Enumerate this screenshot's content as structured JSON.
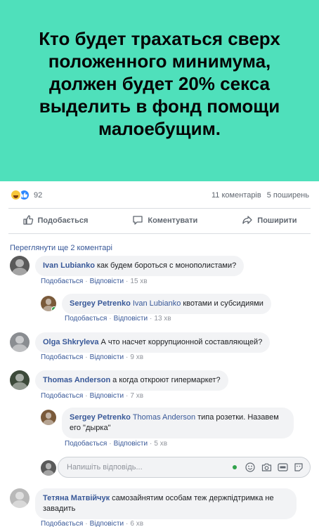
{
  "post": {
    "text": "Кто будет трахаться сверх\nположенного минимума,\nдолжен будет 20% секса\nвыделить в фонд помощи\nмалоебущим.",
    "background_color": "#4fe0bb"
  },
  "stats": {
    "reaction_count": "92",
    "comments": "11 коментарів",
    "shares": "5 поширень"
  },
  "actions": {
    "like": "Подобається",
    "comment": "Коментувати",
    "share": "Поширити"
  },
  "more_comments": "Переглянути ще 2 коментарі",
  "meta_labels": {
    "like": "Подобається",
    "reply": "Відповісти",
    "separator": "·"
  },
  "comments": [
    {
      "author": "Ivan Lubianko",
      "mention": "",
      "text": "как будем бороться с монополистами?",
      "time": "15 хв"
    },
    {
      "author": "Sergey Petrenko",
      "mention": "Ivan Lubianko",
      "text": "квотами и субсидиями",
      "time": "13 хв"
    },
    {
      "author": "Olga Shkryleva",
      "mention": "",
      "text": "А что насчет коррупционной составляющей?",
      "time": "9 хв"
    },
    {
      "author": "Thomas Anderson",
      "mention": "",
      "text": "а когда откроют гипермаркет?",
      "time": "7 хв"
    },
    {
      "author": "Sergey Petrenko",
      "mention": "Thomas Anderson",
      "text": "типа розетки. Назавем",
      "text2": "его \"дырка\"",
      "time": "5 хв"
    },
    {
      "author": "Тетяна Матвійчук",
      "mention": "",
      "text": "самозайнятим особам теж держпідтримка не",
      "text2": "завадить",
      "time": "6 хв"
    }
  ],
  "reply": {
    "placeholder": "Напишіть відповідь..."
  },
  "colors": {
    "link": "#385898",
    "online": "#31a24c"
  }
}
